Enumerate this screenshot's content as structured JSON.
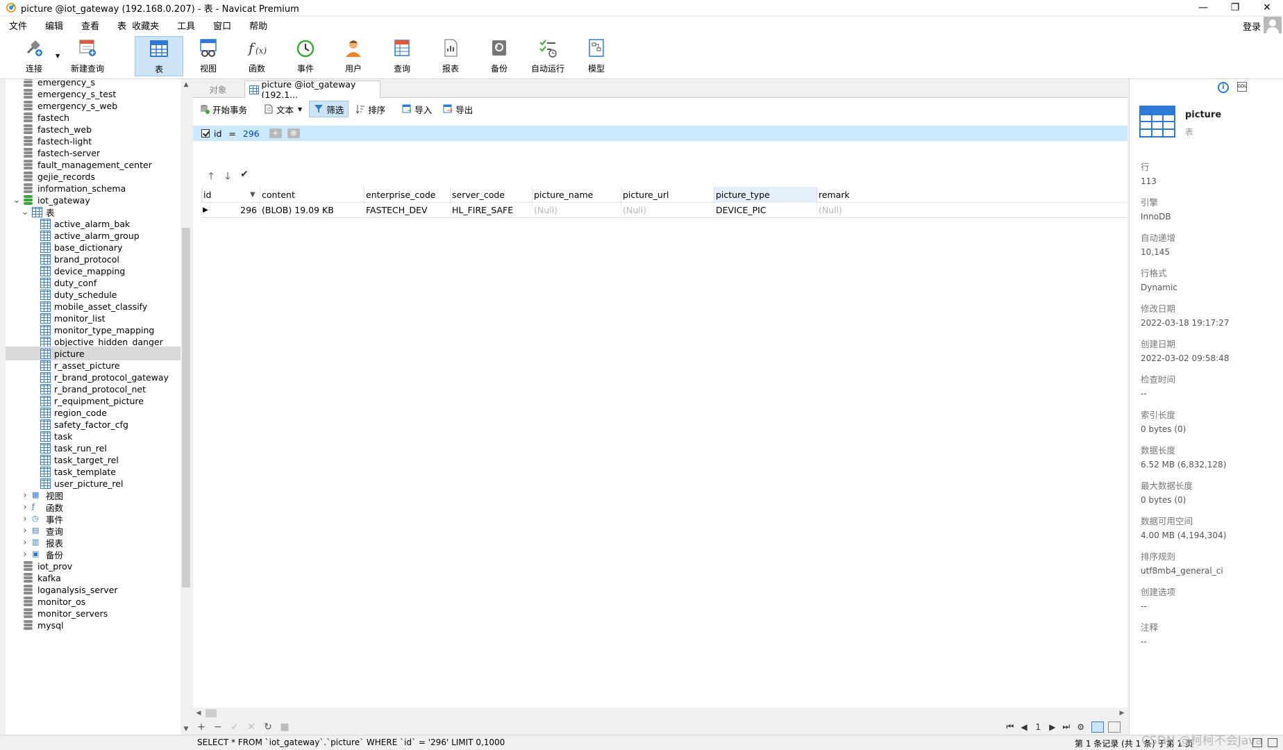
{
  "window": {
    "title": "picture @iot_gateway (192.168.0.207) - 表 - Navicat Premium",
    "minimize": "—",
    "restore": "❐",
    "close": "✕"
  },
  "menu": [
    "文件",
    "编辑",
    "查看",
    "表",
    "收藏夹",
    "工具",
    "窗口",
    "帮助"
  ],
  "login_label": "登录",
  "toolbar": [
    {
      "id": "connect",
      "label": "连接"
    },
    {
      "id": "new-query",
      "label": "新建查询"
    },
    {
      "id": "table",
      "label": "表",
      "active": true
    },
    {
      "id": "view",
      "label": "视图"
    },
    {
      "id": "function",
      "label": "函数"
    },
    {
      "id": "event",
      "label": "事件"
    },
    {
      "id": "user",
      "label": "用户"
    },
    {
      "id": "query",
      "label": "查询"
    },
    {
      "id": "report",
      "label": "报表"
    },
    {
      "id": "backup",
      "label": "备份"
    },
    {
      "id": "automation",
      "label": "自动运行"
    },
    {
      "id": "model",
      "label": "模型"
    }
  ],
  "tree": {
    "databases_before": [
      "emergency_s",
      "emergency_s_test",
      "emergency_s_web",
      "fastech",
      "fastech_web",
      "fastech-light",
      "fastech-server",
      "fault_management_center",
      "gejie_records",
      "information_schema"
    ],
    "open_db": "iot_gateway",
    "tables_folder": "表",
    "tables": [
      "active_alarm_bak",
      "active_alarm_group",
      "base_dictionary",
      "brand_protocol",
      "device_mapping",
      "duty_conf",
      "duty_schedule",
      "mobile_asset_classify",
      "monitor_list",
      "monitor_type_mapping",
      "objective_hidden_danger",
      "picture",
      "r_asset_picture",
      "r_brand_protocol_gateway",
      "r_brand_protocol_net",
      "r_equipment_picture",
      "region_code",
      "safety_factor_cfg",
      "task",
      "task_run_rel",
      "task_target_rel",
      "task_template",
      "user_picture_rel"
    ],
    "selected_table": "picture",
    "folders": [
      "视图",
      "函数",
      "事件",
      "查询",
      "报表",
      "备份"
    ],
    "databases_after": [
      "iot_prov",
      "kafka",
      "loganalysis_server",
      "monitor_os",
      "monitor_servers",
      "mysql"
    ]
  },
  "tabs": {
    "objects": "对象",
    "current": "picture @iot_gateway (192.1..."
  },
  "subtoolbar": {
    "begin_transaction": "开始事务",
    "text": "文本",
    "filter": "筛选",
    "sort": "排序",
    "import": "导入",
    "export": "导出"
  },
  "filter": {
    "field": "id",
    "operator": "=",
    "value": "296",
    "plus": "+",
    "more": "⊕"
  },
  "grid": {
    "columns": [
      "id",
      "content",
      "enterprise_code",
      "server_code",
      "picture_name",
      "picture_url",
      "picture_type",
      "remark"
    ],
    "rows": [
      [
        "296",
        "(BLOB) 19.09 KB",
        "FASTECH_DEV",
        "HL_FIRE_SAFE",
        "(Null)",
        "(Null)",
        "DEVICE_PIC",
        "(Null)"
      ]
    ]
  },
  "pager": {
    "page": "1"
  },
  "info": {
    "name": "picture",
    "type": "表",
    "props": [
      {
        "k": "行",
        "v": "113"
      },
      {
        "k": "引擎",
        "v": "InnoDB"
      },
      {
        "k": "自动递增",
        "v": "10,145"
      },
      {
        "k": "行格式",
        "v": "Dynamic"
      },
      {
        "k": "修改日期",
        "v": "2022-03-18 19:17:27"
      },
      {
        "k": "创建日期",
        "v": "2022-03-02 09:58:48"
      },
      {
        "k": "检查时间",
        "v": "--"
      },
      {
        "k": "索引长度",
        "v": "0 bytes (0)"
      },
      {
        "k": "数据长度",
        "v": "6.52 MB (6,832,128)"
      },
      {
        "k": "最大数据长度",
        "v": "0 bytes (0)"
      },
      {
        "k": "数据可用空间",
        "v": "4.00 MB (4,194,304)"
      },
      {
        "k": "排序规则",
        "v": "utf8mb4_general_ci"
      },
      {
        "k": "创建选项",
        "v": "--"
      },
      {
        "k": "注释",
        "v": "--"
      }
    ]
  },
  "status": {
    "sql": "SELECT * FROM `iot_gateway`.`picture` WHERE `id` = '296' LIMIT 0,1000",
    "records": "第 1 条记录 (共 1 条) 于第 1 页",
    "watermark": "CSDN @柯柯不会Java"
  },
  "colors": {
    "accent": "#2e79d6",
    "filter_bg": "#cce8ff",
    "selected_row": "#d9d9d9"
  }
}
